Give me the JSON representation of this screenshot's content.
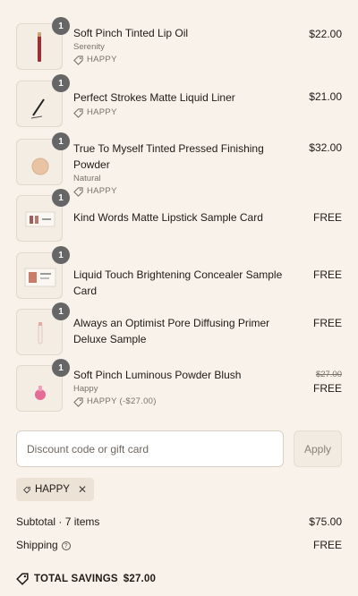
{
  "line_items": [
    {
      "quantity": "1",
      "name": "Soft Pinch Tinted Lip Oil",
      "variant": "Serenity",
      "discount": "HAPPY",
      "price": "$22.00",
      "original_price": "",
      "thumb_icon": "lip-oil-icon"
    },
    {
      "quantity": "1",
      "name": "Perfect Strokes Matte Liquid Liner",
      "variant": "",
      "discount": "HAPPY",
      "price": "$21.00",
      "original_price": "",
      "thumb_icon": "liquid-liner-icon"
    },
    {
      "quantity": "1",
      "name": "True To Myself Tinted Pressed Finishing Powder",
      "variant": "Natural",
      "discount": "HAPPY",
      "price": "$32.00",
      "original_price": "",
      "thumb_icon": "pressed-powder-icon"
    },
    {
      "quantity": "1",
      "name": "Kind Words Matte Lipstick Sample Card",
      "variant": "",
      "discount": "",
      "price": "FREE",
      "original_price": "",
      "thumb_icon": "sample-card-icon"
    },
    {
      "quantity": "1",
      "name": "Liquid Touch Brightening Concealer Sample Card",
      "variant": "",
      "discount": "",
      "price": "FREE",
      "original_price": "",
      "thumb_icon": "sample-card-icon"
    },
    {
      "quantity": "1",
      "name": "Always an Optimist Pore Diffusing Primer Deluxe Sample",
      "variant": "",
      "discount": "",
      "price": "FREE",
      "original_price": "",
      "thumb_icon": "primer-icon"
    },
    {
      "quantity": "1",
      "name": "Soft Pinch Luminous Powder Blush",
      "variant": "Happy",
      "discount": "HAPPY (-$27.00)",
      "price": "FREE",
      "original_price": "$27.00",
      "thumb_icon": "blush-icon"
    }
  ],
  "discount": {
    "placeholder": "Discount code or gift card",
    "value": "",
    "apply_label": "Apply",
    "applied_code": "HAPPY"
  },
  "summary": {
    "subtotal_label": "Subtotal · 7 items",
    "subtotal_value": "$75.00",
    "shipping_label": "Shipping",
    "shipping_value": "FREE",
    "savings_label": "TOTAL SAVINGS",
    "savings_value": "$27.00"
  },
  "colors": {
    "background": "#f8f2ea",
    "badge": "#666666",
    "muted_text": "#7a716a"
  }
}
